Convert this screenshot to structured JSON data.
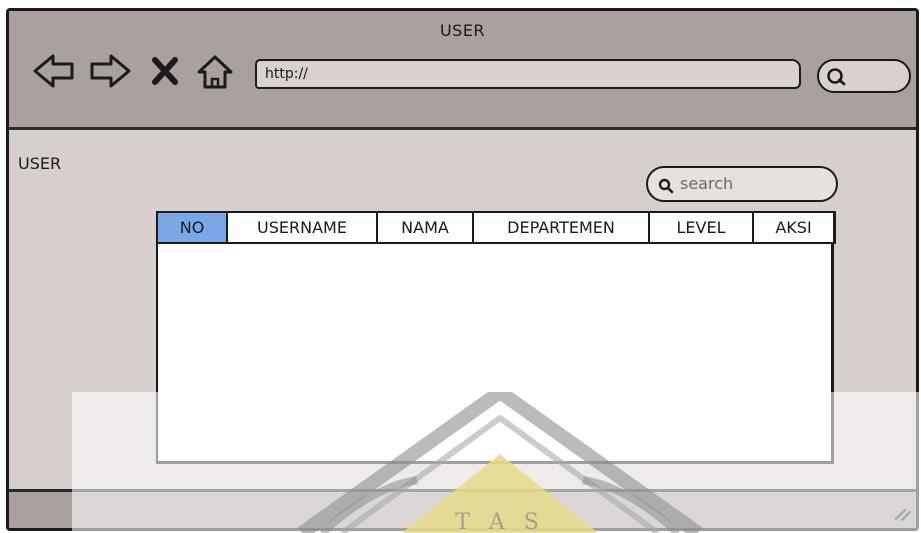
{
  "window": {
    "title": "USER"
  },
  "toolbar": {
    "icons": [
      "back-arrow-icon",
      "forward-arrow-icon",
      "close-x-icon",
      "home-icon"
    ],
    "url": "http://",
    "search_icon": "search-icon"
  },
  "page": {
    "title": "USER",
    "search": {
      "placeholder": "search"
    },
    "table": {
      "columns": [
        "NO",
        "USERNAME",
        "NAMA",
        "DEPARTEMEN",
        "LEVEL",
        "AKSI"
      ],
      "selected_column": "NO",
      "selected_color": "#7aa8e6",
      "rows": []
    }
  },
  "watermark": {
    "text": "T A S",
    "accent_color": "#e5d98a"
  },
  "colors": {
    "chrome": "#aaa19e",
    "page_background": "#d6cfcc"
  }
}
